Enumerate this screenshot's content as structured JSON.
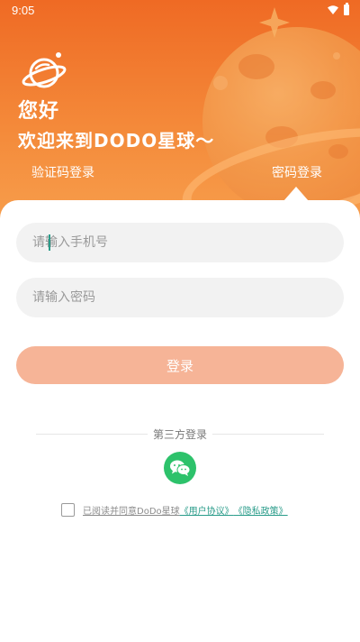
{
  "status_bar": {
    "time": "9:05"
  },
  "header": {
    "greeting": "您好",
    "welcome": "欢迎来到DODO星球～",
    "tabs": {
      "sms_login": "验证码登录",
      "password_login": "密码登录"
    }
  },
  "form": {
    "phone_placeholder": "请输入手机号",
    "password_placeholder": "请输入密码",
    "login_label": "登录"
  },
  "third_party": {
    "label": "第三方登录",
    "wechat_icon": "wechat-icon"
  },
  "agreement": {
    "prefix": "已阅读并同意DoDo星球",
    "user_agreement": "《用户协议》",
    "privacy_policy": "《隐私政策》"
  },
  "colors": {
    "brand_orange": "#ef6a24",
    "login_button": "#f6b497",
    "wechat_green": "#2dc26b",
    "link_teal": "#2a9c8a"
  }
}
